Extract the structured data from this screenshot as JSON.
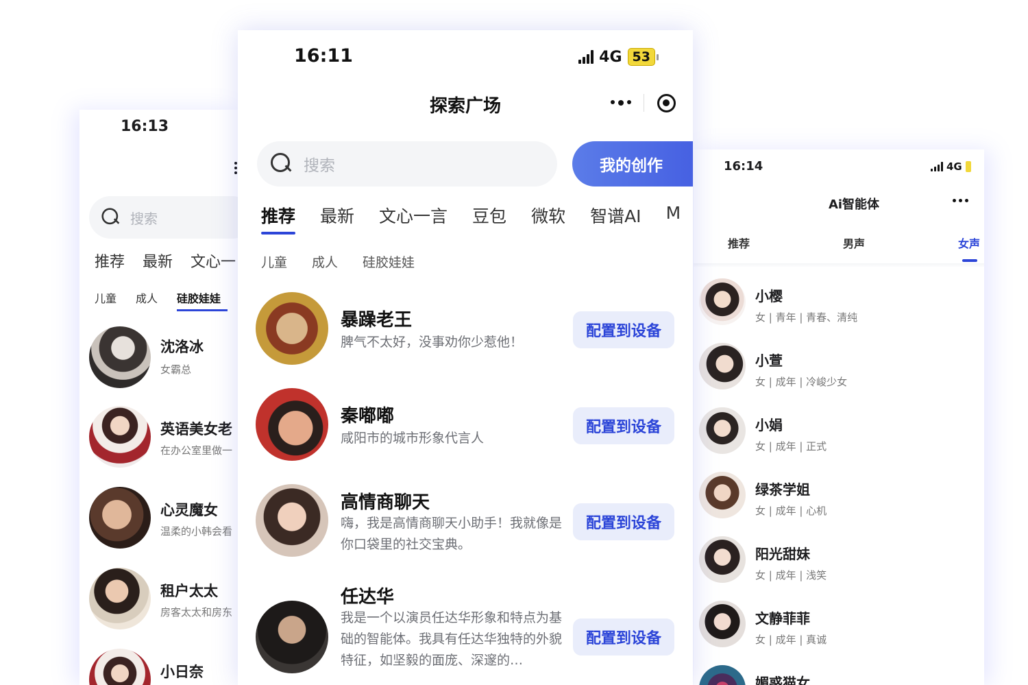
{
  "left": {
    "time": "16:13",
    "search_placeholder": "搜索",
    "tabs": [
      "推荐",
      "最新",
      "文心一"
    ],
    "subtabs": [
      "儿童",
      "成人",
      "硅胶娃娃"
    ],
    "active_subtab": "硅胶娃娃",
    "items": [
      {
        "name": "沈洛冰",
        "desc": "女霸总"
      },
      {
        "name": "英语美女老",
        "desc": "在办公室里做一"
      },
      {
        "name": "心灵魔女",
        "desc": "温柔的小韩会看"
      },
      {
        "name": "租户太太",
        "desc": "房客太太和房东"
      },
      {
        "name": "小日奈",
        "desc": ""
      }
    ]
  },
  "center": {
    "time": "16:11",
    "network": "4G",
    "battery": "53",
    "title": "探索广场",
    "search_placeholder": "搜索",
    "create_button": "我的创作",
    "tabs": [
      "推荐",
      "最新",
      "文心一言",
      "豆包",
      "微软",
      "智谱AI",
      "M"
    ],
    "active_tab": "推荐",
    "subtabs": [
      "儿童",
      "成人",
      "硅胶娃娃"
    ],
    "configure_label": "配置到设备",
    "items": [
      {
        "name": "暴躁老王",
        "desc": "脾气不太好，没事劝你少惹他！"
      },
      {
        "name": "秦嘟嘟",
        "desc": "咸阳市的城市形象代言人"
      },
      {
        "name": "高情商聊天",
        "desc": "嗨，我是高情商聊天小助手！我就像是你口袋里的社交宝典。"
      },
      {
        "name": "任达华",
        "desc": "我是一个以演员任达华形象和特点为基础的智能体。我具有任达华独特的外貌特征，如坚毅的面庞、深邃的…"
      }
    ]
  },
  "right": {
    "time": "16:14",
    "network": "4G",
    "title": "Ai智能体",
    "tabs": [
      "推荐",
      "男声",
      "女声"
    ],
    "active_tab": "女声",
    "items": [
      {
        "name": "小樱",
        "desc": "女 | 青年 | 青春、清纯"
      },
      {
        "name": "小萱",
        "desc": "女 | 成年 | 冷峻少女"
      },
      {
        "name": "小娟",
        "desc": "女 | 成年 | 正式"
      },
      {
        "name": "绿茶学姐",
        "desc": "女 | 成年 | 心机"
      },
      {
        "name": "阳光甜妹",
        "desc": "女 | 成年 | 浅笑"
      },
      {
        "name": "文静菲菲",
        "desc": "女 | 成年 | 真诚"
      },
      {
        "name": "媚惑猫女",
        "desc": ""
      }
    ]
  }
}
